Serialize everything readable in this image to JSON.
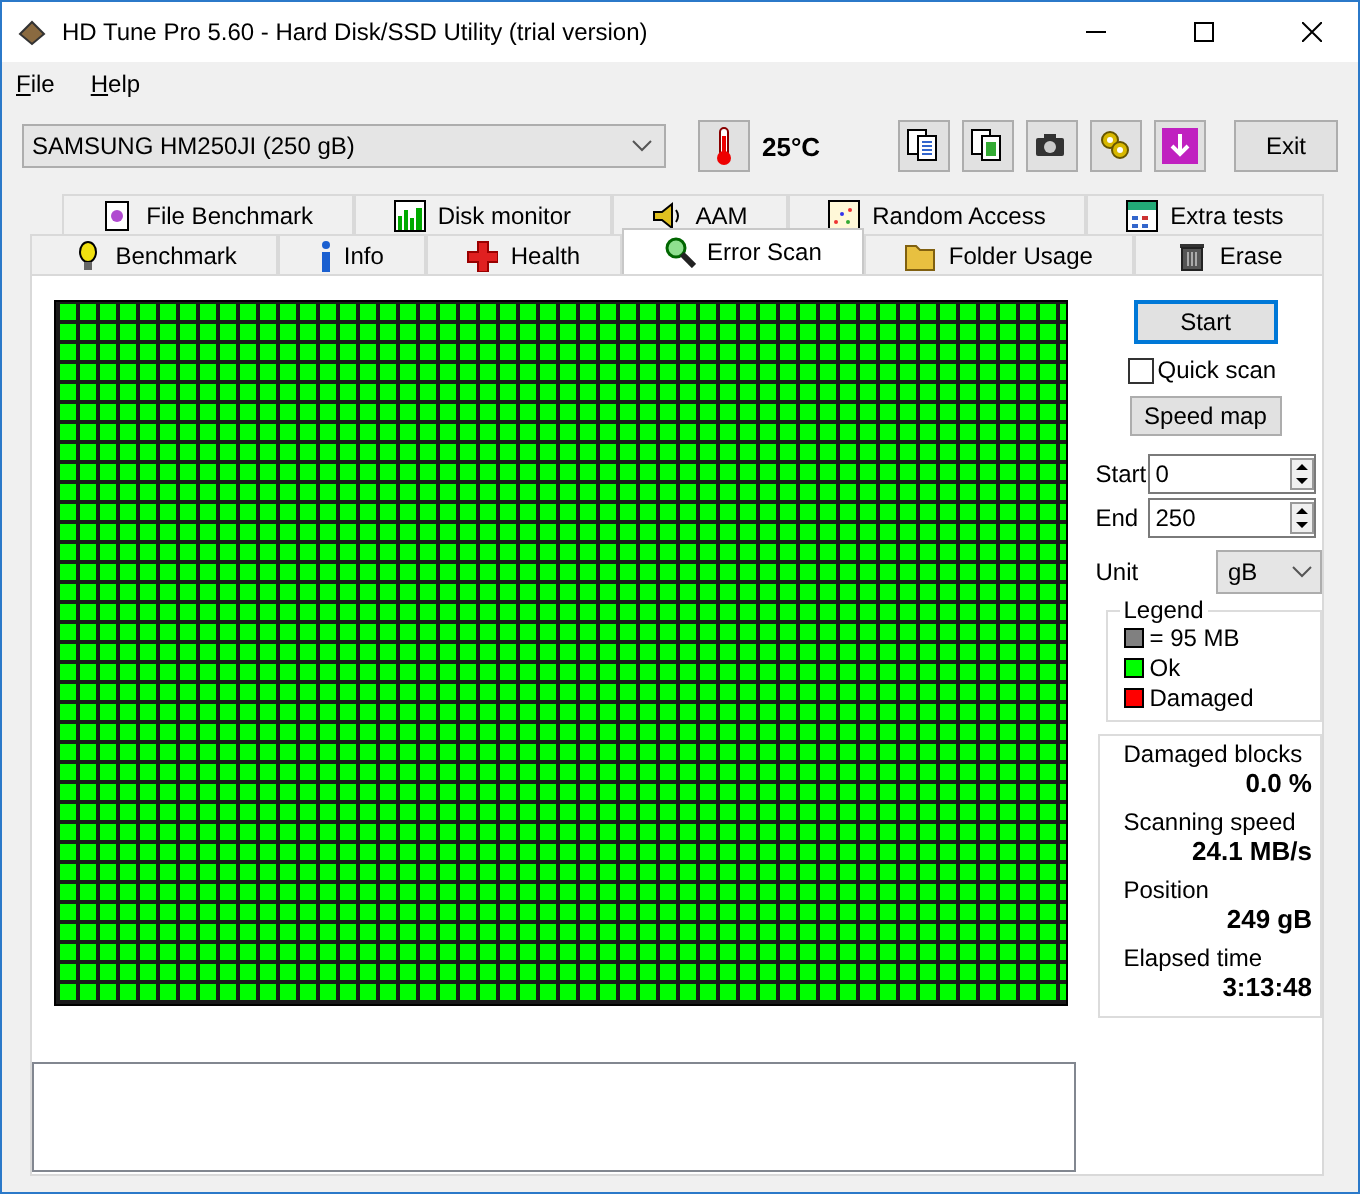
{
  "window": {
    "title": "HD Tune Pro 5.60 - Hard Disk/SSD Utility (trial version)"
  },
  "menu": [
    {
      "label": "File"
    },
    {
      "label": "Help"
    }
  ],
  "toolbar": {
    "drive": "SAMSUNG HM250JI (250 gB)",
    "temperature": "25°C",
    "tool_buttons": [
      {
        "kind": "copy-text"
      },
      {
        "kind": "copy-image"
      },
      {
        "kind": "camera"
      },
      {
        "kind": "gears"
      },
      {
        "kind": "download"
      }
    ],
    "exit": "Exit"
  },
  "tab_rows": [
    {
      "tabs": [
        {
          "label": "File Benchmark",
          "kind": "file",
          "selected": false
        },
        {
          "label": "Disk monitor",
          "kind": "monitor",
          "selected": false
        },
        {
          "label": "AAM",
          "kind": "speaker",
          "selected": false
        },
        {
          "label": "Random Access",
          "kind": "scatter",
          "selected": false
        },
        {
          "label": "Extra tests",
          "kind": "calendar",
          "selected": false
        }
      ]
    },
    {
      "tabs": [
        {
          "label": "Benchmark",
          "kind": "bulb",
          "selected": false
        },
        {
          "label": "Info",
          "kind": "info",
          "selected": false
        },
        {
          "label": "Health",
          "kind": "cross",
          "selected": false
        },
        {
          "label": "Error Scan",
          "kind": "magnifier",
          "selected": true
        },
        {
          "label": "Folder Usage",
          "kind": "folder",
          "selected": false
        },
        {
          "label": "Erase",
          "kind": "bin",
          "selected": false
        }
      ]
    }
  ],
  "scan": {
    "start_button": "Start",
    "quick_scan": {
      "label": "Quick scan",
      "checked": false
    },
    "speed_map_button": "Speed map",
    "range": [
      {
        "label": "Start",
        "value": "0"
      },
      {
        "label": "End",
        "value": "250"
      }
    ],
    "unit": {
      "label": "Unit",
      "value": "gB"
    },
    "legend": {
      "title": "Legend",
      "items": [
        {
          "label": "= 95 MB",
          "color": "#808080"
        },
        {
          "label": "Ok",
          "color": "#00ff00"
        },
        {
          "label": "Damaged",
          "color": "#ff0000"
        }
      ]
    },
    "stats": [
      {
        "label": "Damaged blocks",
        "value": "0.0 %"
      },
      {
        "label": "Scanning speed",
        "value": "24.1 MB/s"
      },
      {
        "label": "Position",
        "value": "249 gB"
      },
      {
        "label": "Elapsed time",
        "value": "3:13:48"
      }
    ]
  }
}
